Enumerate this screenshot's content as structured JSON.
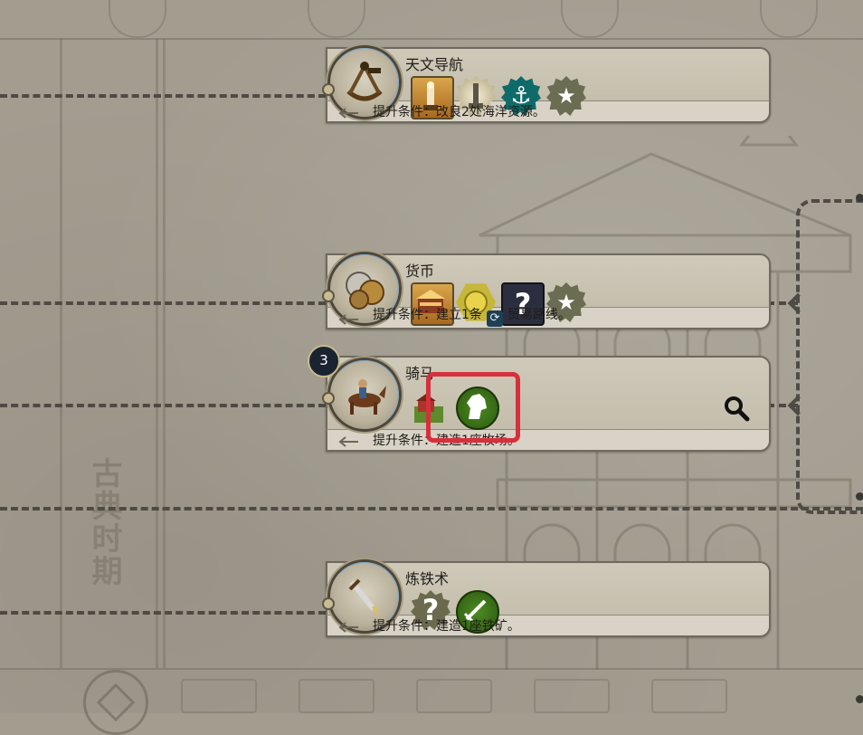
{
  "era_label": "古典时期",
  "era_badge": "3",
  "requirement_prefix": "提升条件：",
  "cards": [
    {
      "key": "celestial-navigation",
      "title": "天文导航",
      "portrait_icon": "sextant-icon",
      "requirement_text": "改良2处海洋资源。",
      "unlocks": [
        "lighthouse-building-icon",
        "great-lighthouse-wonder-icon",
        "harbor-anchor-icon",
        "star-icon"
      ]
    },
    {
      "key": "currency",
      "title": "货币",
      "portrait_icon": "coins-icon",
      "requirement_text_before_icon": "建立1条",
      "requirement_inline_icon": "trade-route-icon",
      "requirement_text_after_icon": "贸易路线。",
      "unlocks": [
        "market-building-icon",
        "gold-coin-icon",
        "unknown-question-icon",
        "star-icon"
      ]
    },
    {
      "key": "horseback-riding",
      "title": "骑马",
      "portrait_icon": "horse-rider-icon",
      "requirement_text": "建造1座牧场。",
      "unlocks": [
        "pasture-improvement-icon",
        "horse-head-icon"
      ],
      "has_search": true
    },
    {
      "key": "iron-working",
      "title": "炼铁术",
      "portrait_icon": "dagger-icon",
      "requirement_text": "建造1座铁矿。",
      "unlocks": [
        "unknown-question-icon",
        "sword-icon"
      ]
    }
  ],
  "colors": {
    "highlight": "#d6303d",
    "card_bg": "#cfc9b9",
    "dashed_line": "#4e4b45",
    "progress_ring": "#7fa5c5"
  }
}
